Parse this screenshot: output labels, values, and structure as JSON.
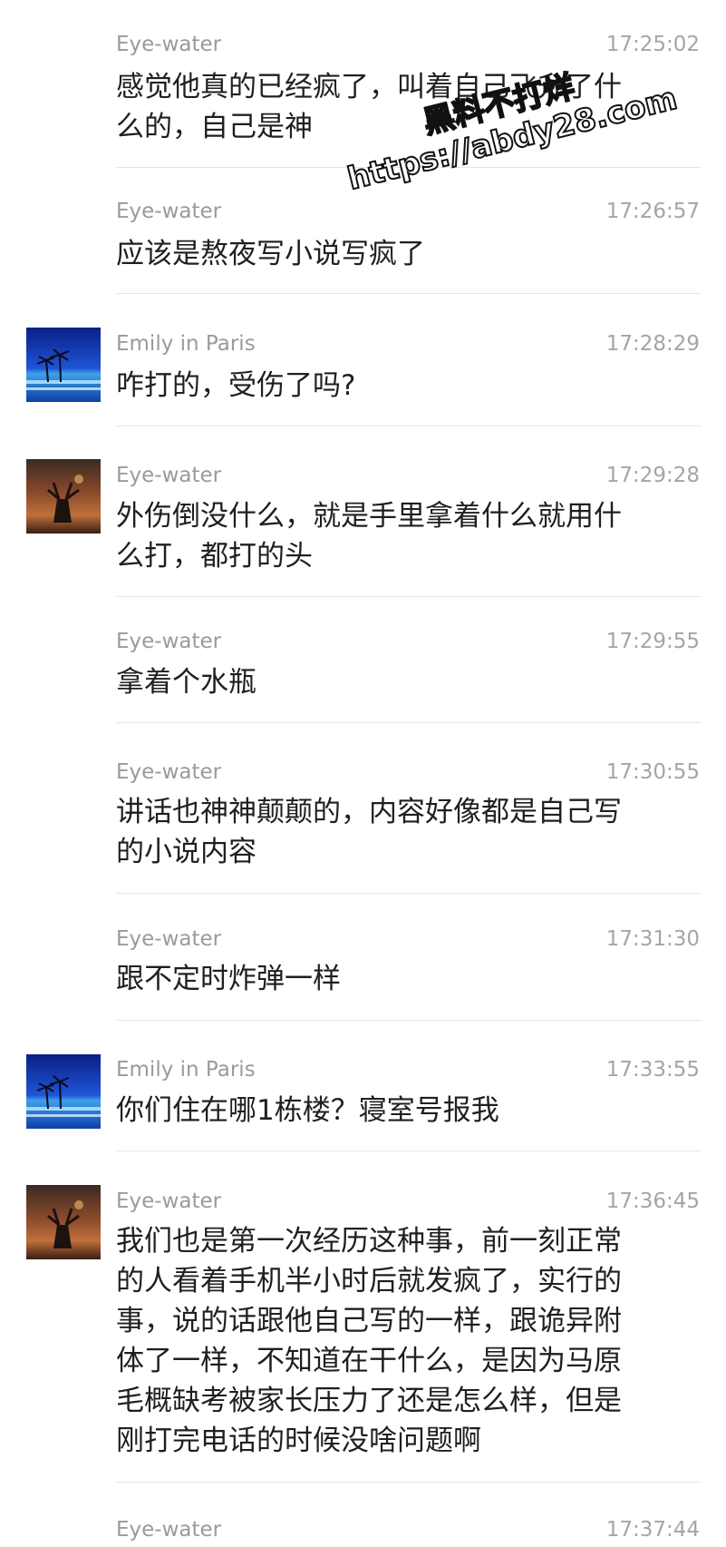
{
  "messages": [
    {
      "sender": "Eye-water",
      "time": "17:25:02",
      "text": "感觉他真的已经疯了，叫着自己飞升了什\n么的，自己是神",
      "avatar": "none"
    },
    {
      "sender": "Eye-water",
      "time": "17:26:57",
      "text": "应该是熬夜写小说写疯了",
      "avatar": "none"
    },
    {
      "sender": "Emily in Paris",
      "time": "17:28:29",
      "text": "咋打的，受伤了吗?",
      "avatar": "beach-palm"
    },
    {
      "sender": "Eye-water",
      "time": "17:29:28",
      "text": "外伤倒没什么，就是手里拿着什么就用什\n么打，都打的头",
      "avatar": "deer-sunset"
    },
    {
      "sender": "Eye-water",
      "time": "17:29:55",
      "text": "拿着个水瓶",
      "avatar": "none"
    },
    {
      "sender": "Eye-water",
      "time": "17:30:55",
      "text": "讲话也神神颠颠的，内容好像都是自己写\n的小说内容",
      "avatar": "none"
    },
    {
      "sender": "Eye-water",
      "time": "17:31:30",
      "text": "跟不定时炸弹一样",
      "avatar": "none"
    },
    {
      "sender": "Emily in Paris",
      "time": "17:33:55",
      "text": "你们住在哪1栋楼？寝室号报我",
      "avatar": "beach-palm"
    },
    {
      "sender": "Eye-water",
      "time": "17:36:45",
      "text": "我们也是第一次经历这种事，前一刻正常\n的人看着手机半小时后就发疯了，实行的\n事，说的话跟他自己写的一样，跟诡异附\n体了一样，不知道在干什么，是因为马原\n毛概缺考被家长压力了还是怎么样，但是\n刚打完电话的时候没啥问题啊",
      "avatar": "deer-sunset"
    },
    {
      "sender": "Eye-water",
      "time": "17:37:44",
      "text": "",
      "avatar": "none"
    }
  ],
  "watermark": {
    "line1": "黑料不打烊",
    "line2": "https://abdy28.com"
  },
  "colors": {
    "sender": "#9a9a9a",
    "time": "#a5a5a5",
    "text": "#1f1f1f",
    "divider": "#e6e6e6"
  }
}
